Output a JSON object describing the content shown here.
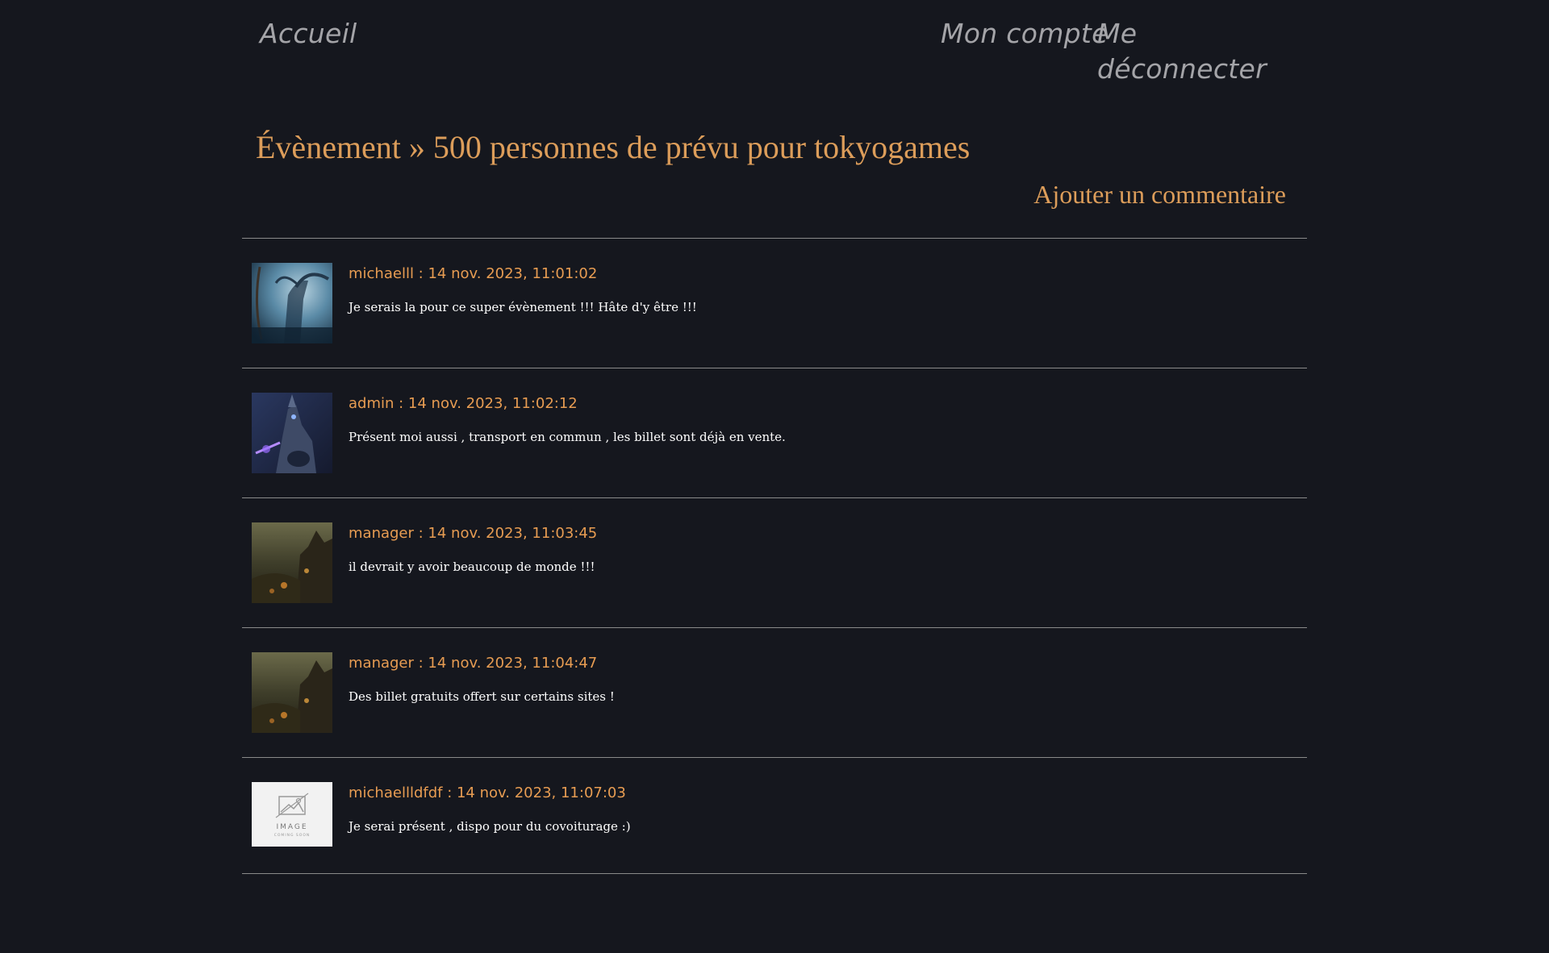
{
  "nav": {
    "home_label": "Accueil",
    "account_label": "Mon compte",
    "logout_label": "Me déconnecter"
  },
  "page": {
    "title": "Évènement » 500 personnes de prévu pour tokyogames",
    "add_comment_label": "Ajouter un commentaire"
  },
  "colors": {
    "background": "#15171e",
    "accent": "#dc9d5a",
    "nav_text": "#a4a4a8",
    "comment_text": "#ffffff",
    "divider": "#8a8a8a"
  },
  "comments": [
    {
      "meta": "michaelll : 14 nov. 2023, 11:01:02",
      "text": "Je serais la pour ce super évènement !!! Hâte d'y être !!!",
      "avatar": "misty-forest-archer-avatar"
    },
    {
      "meta": "admin : 14 nov. 2023, 11:02:12",
      "text": "Présent moi aussi , transport en commun , les billet sont déjà en vente.",
      "avatar": "armored-knight-avatar"
    },
    {
      "meta": "manager : 14 nov. 2023, 11:03:45",
      "text": "il devrait y avoir beaucoup de monde !!!",
      "avatar": "castle-landscape-avatar"
    },
    {
      "meta": "manager : 14 nov. 2023, 11:04:47",
      "text": "Des billet gratuits offert sur certains sites !",
      "avatar": "castle-landscape-avatar"
    },
    {
      "meta": "michaellldfdf : 14 nov. 2023, 11:07:03",
      "text": "Je serai présent , dispo pour du covoiturage :)",
      "avatar": "image-placeholder-avatar",
      "placeholder_line1": "IMAGE",
      "placeholder_line2": "COMING SOON"
    }
  ]
}
